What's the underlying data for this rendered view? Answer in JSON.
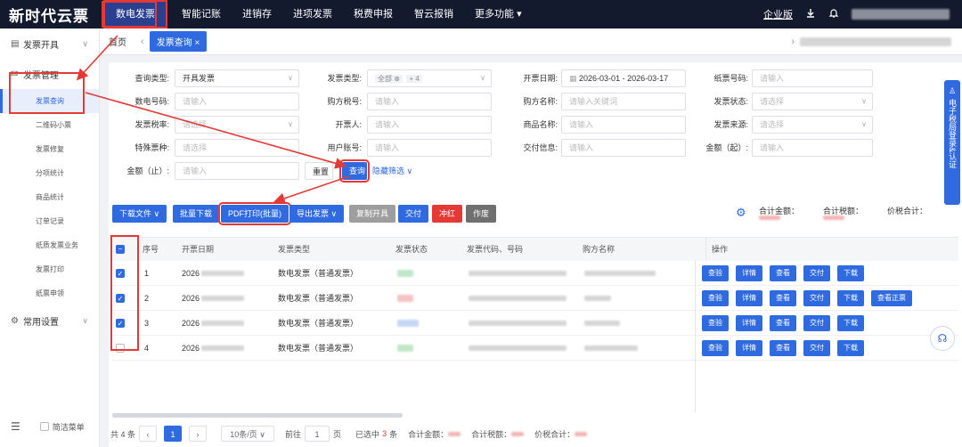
{
  "app": {
    "logo": "新时代云票"
  },
  "nav": {
    "items": [
      "数电发票",
      "智能记账",
      "进销存",
      "进项发票",
      "税费申报",
      "智云报销",
      "更多功能"
    ],
    "more_chevron": "▾",
    "edition": "企业版"
  },
  "sidebar": {
    "group1": "发票开具",
    "group2": "发票管理",
    "subitems": [
      "发票查询",
      "二维码小票",
      "发票修复",
      "分项统计",
      "商品统计",
      "订单记录",
      "纸质发票业务",
      "发票打印",
      "纸票申领"
    ],
    "group3": "常用设置",
    "simple_menu": "简洁菜单"
  },
  "tabs": {
    "home": "首页",
    "active": "发票查询",
    "close": "×"
  },
  "form": {
    "query_type": {
      "label": "查询类型:",
      "value": "开具发票"
    },
    "invoice_type": {
      "label": "发票类型:",
      "chip": "全部",
      "more": "+ 4"
    },
    "issue_date": {
      "label": "开票日期:",
      "value": "2026-03-01 - 2026-03-17"
    },
    "paper_no": {
      "label": "纸票号码:",
      "placeholder": "请输入"
    },
    "digital_no": {
      "label": "数电号码:",
      "placeholder": "请输入"
    },
    "buyer_tax": {
      "label": "购方税号:",
      "placeholder": "请输入"
    },
    "buyer_name": {
      "label": "购方名称:",
      "placeholder": "请输入关键词"
    },
    "invoice_status": {
      "label": "发票状态:",
      "placeholder": "请选择"
    },
    "tax_rate": {
      "label": "发票税率:",
      "placeholder": "请选择"
    },
    "issuer": {
      "label": "开票人:",
      "placeholder": "请输入"
    },
    "goods_name": {
      "label": "商品名称:",
      "placeholder": "请输入"
    },
    "invoice_source": {
      "label": "发票来源:",
      "placeholder": "请选择"
    },
    "special": {
      "label": "特殊票种:",
      "placeholder": "请选择"
    },
    "user_account": {
      "label": "用户账号:",
      "placeholder": "请输入"
    },
    "delivery": {
      "label": "交付信息:",
      "placeholder": "请输入"
    },
    "amount_from": {
      "label": "金额（起）:",
      "placeholder": "请输入"
    },
    "amount_to": {
      "label": "金额（止）:",
      "placeholder": "请输入"
    },
    "reset": "重置",
    "search": "查询",
    "hide_filter": "隐藏筛选"
  },
  "toolbar": {
    "download_file": "下载文件",
    "batch_download": "批量下载",
    "pdf_print": "PDF打印(批量)",
    "export": "导出发票",
    "copy_issue": "复制开具",
    "deliver": "交付",
    "red": "冲红",
    "void": "作废",
    "total_amount": "合计金额：",
    "total_tax": "合计税额：",
    "total_price_tax": "价税合计："
  },
  "table": {
    "headers": [
      "序号",
      "开票日期",
      "发票类型",
      "发票状态",
      "发票代码、号码",
      "购方名称",
      "操作"
    ],
    "rows": [
      {
        "no": "1",
        "date": "2026",
        "type": "数电发票（普通发票）",
        "checked": true,
        "ops": [
          "查验",
          "详情",
          "查看",
          "交付",
          "下载"
        ]
      },
      {
        "no": "2",
        "date": "2026",
        "type": "数电发票（普通发票）",
        "checked": true,
        "ops": [
          "查验",
          "详情",
          "查看",
          "交付",
          "下载",
          "查看正票"
        ]
      },
      {
        "no": "3",
        "date": "2026",
        "type": "数电发票（普通发票）",
        "checked": true,
        "ops": [
          "查验",
          "详情",
          "查看",
          "交付",
          "下载"
        ]
      },
      {
        "no": "4",
        "date": "2026",
        "type": "数电发票（普通发票）",
        "checked": false,
        "ops": [
          "查验",
          "详情",
          "查看",
          "交付",
          "下载"
        ]
      }
    ]
  },
  "footer": {
    "total": "共 4 条",
    "page": "1",
    "page_size": "10条/页",
    "goto": "前往",
    "goto_page": "1",
    "page_unit": "页",
    "selected_prefix": "已选中",
    "selected_count": "3",
    "selected_unit": "条",
    "total_amount": "合计金额：",
    "total_tax": "合计税额：",
    "total_price_tax": "价税合计："
  },
  "right_panel": {
    "label": "电子税局登录&认证"
  },
  "colors": {
    "primary": "#2f6ae0",
    "topbar": "#141a2e",
    "danger": "#e53935",
    "highlight": "#e53935"
  }
}
